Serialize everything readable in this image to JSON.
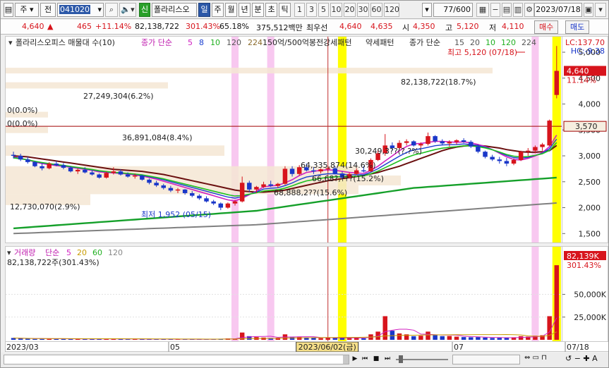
{
  "toolbar": {
    "market": "주",
    "type_label": "전",
    "code": "041020",
    "badge_new": "신",
    "stock_name": "폴라리스오",
    "periods": [
      "일",
      "주",
      "월",
      "년",
      "분",
      "초",
      "틱"
    ],
    "active_period": "일",
    "intervals": [
      "1",
      "3",
      "5",
      "10",
      "20",
      "30",
      "60",
      "120"
    ],
    "count": "77",
    "count_total": "/600",
    "date": "2023/07/18"
  },
  "quote": {
    "price": "4,640",
    "arrow": "▲",
    "change": "465",
    "change_pct": "+11.14%",
    "volume": "82,138,722",
    "volume_pct": "301.43%",
    "ratio": "65.18%",
    "amount": "375,512백만",
    "best_label": "최우선",
    "ask": "4,640",
    "bid": "4,635",
    "open_label": "시",
    "open": "4,350",
    "high_label": "고",
    "high": "5,120",
    "low_label": "저",
    "low": "4,110",
    "buy_label": "매수",
    "sell_label": "매도"
  },
  "price_legend": {
    "name": "폴라리스오피스 매물대 수(10)",
    "ma_label": "종가 단순",
    "ma_periods": [
      "5",
      "8",
      "10",
      "120",
      "224"
    ],
    "ma_colors": [
      "#d020c0",
      "#1a3fd0",
      "#20b020",
      "#555555",
      "#8a6a2a"
    ],
    "item3": "150억/500억봉전",
    "item4": "강세패턴",
    "item5": "약세패턴",
    "item6_label": "종가 단순",
    "item6_periods": [
      "15",
      "20",
      "10",
      "120",
      "224"
    ]
  },
  "price_notes": {
    "high_note": "최고 5,120 (07/18)",
    "low_note": "최저 1,952 (05/15)",
    "lc": "LC:137.70",
    "hc": "HC:-9.38",
    "cur_price": "4,640",
    "cur_pct": "11.14%",
    "ref_line": "3,570"
  },
  "price_axis": [
    "5,000",
    "4,500",
    "4,000",
    "3,500",
    "3,000",
    "2,500",
    "2,000",
    "1,500"
  ],
  "profile_labels": [
    {
      "text": "82,138,722(18.7%)"
    },
    {
      "text": "27,249,304(6.2%)"
    },
    {
      "text": "0(0.0%)"
    },
    {
      "text": "0(0.0%)"
    },
    {
      "text": "36,891,084(8.4%)"
    },
    {
      "text": "64,335,874(14.6%)"
    },
    {
      "text": "66,68?,???(15.2%)"
    },
    {
      "text": "68,888,2??(15.6%)"
    },
    {
      "text": "12,730,070(2.9%)"
    },
    {
      "text": "30,249,3??(?.?%)"
    }
  ],
  "volume_legend": {
    "name": "거래량",
    "ma_label": "단순",
    "periods": [
      "5",
      "20",
      "60",
      "120"
    ],
    "colors": [
      "#d020c0",
      "#c89b00",
      "#20b020",
      "#888888"
    ],
    "current": "82,138,722주(301.43%)",
    "axis_cur": "82,139K",
    "axis_pct": "301.43%"
  },
  "volume_axis": [
    "50,000K",
    "25,000K"
  ],
  "date_axis": {
    "labels": [
      "2023/03",
      "05",
      "07",
      "07/18"
    ],
    "cursor": "2023/06/02(금)"
  },
  "colors": {
    "up": "#d7141c",
    "down": "#1a37c9",
    "highlight_pink": "#f8c8f0",
    "highlight_yellow": "#ffff00",
    "profile": "#f4e6d4"
  },
  "chart_data": {
    "type": "candlestick",
    "y_range": [
      1300,
      5300
    ],
    "candles": [
      [
        3020,
        3080,
        2950,
        3000
      ],
      [
        3000,
        3040,
        2900,
        2930
      ],
      [
        2930,
        2980,
        2850,
        2880
      ],
      [
        2880,
        2900,
        2780,
        2800
      ],
      [
        2800,
        2850,
        2720,
        2760
      ],
      [
        2760,
        2880,
        2740,
        2850
      ],
      [
        2850,
        2900,
        2800,
        2820
      ],
      [
        2820,
        2860,
        2740,
        2770
      ],
      [
        2770,
        2800,
        2680,
        2700
      ],
      [
        2700,
        2760,
        2650,
        2730
      ],
      [
        2730,
        2780,
        2660,
        2680
      ],
      [
        2680,
        2720,
        2620,
        2640
      ],
      [
        2640,
        2660,
        2560,
        2580
      ],
      [
        2580,
        2700,
        2560,
        2670
      ],
      [
        2670,
        2780,
        2640,
        2700
      ],
      [
        2700,
        2740,
        2620,
        2640
      ],
      [
        2640,
        2680,
        2580,
        2600
      ],
      [
        2600,
        2660,
        2560,
        2620
      ],
      [
        2620,
        2640,
        2520,
        2540
      ],
      [
        2540,
        2560,
        2450,
        2480
      ],
      [
        2480,
        2520,
        2400,
        2430
      ],
      [
        2430,
        2460,
        2350,
        2380
      ],
      [
        2380,
        2420,
        2300,
        2330
      ],
      [
        2330,
        2380,
        2280,
        2350
      ],
      [
        2350,
        2360,
        2250,
        2280
      ],
      [
        2280,
        2320,
        2200,
        2230
      ],
      [
        2230,
        2260,
        2150,
        2180
      ],
      [
        2180,
        2220,
        2100,
        2120
      ],
      [
        2120,
        2150,
        2050,
        2080
      ],
      [
        2080,
        2100,
        1952,
        2000
      ],
      [
        2000,
        2100,
        1980,
        2080
      ],
      [
        2080,
        2150,
        2040,
        2120
      ],
      [
        2120,
        2600,
        2100,
        2480
      ],
      [
        2480,
        2520,
        2300,
        2350
      ],
      [
        2350,
        2420,
        2280,
        2400
      ],
      [
        2400,
        2500,
        2380,
        2450
      ],
      [
        2450,
        2520,
        2400,
        2420
      ],
      [
        2420,
        2480,
        2380,
        2460
      ],
      [
        2460,
        2800,
        2440,
        2750
      ],
      [
        2750,
        2800,
        2600,
        2650
      ],
      [
        2650,
        2820,
        2620,
        2780
      ],
      [
        2780,
        2850,
        2700,
        2720
      ],
      [
        2720,
        2780,
        2650,
        2700
      ],
      [
        2700,
        2760,
        2660,
        2740
      ],
      [
        2740,
        2800,
        2700,
        2760
      ],
      [
        2760,
        2800,
        2640,
        2660
      ],
      [
        2660,
        2700,
        2550,
        2580
      ],
      [
        2580,
        2680,
        2560,
        2650
      ],
      [
        2650,
        2760,
        2630,
        2720
      ],
      [
        2720,
        2800,
        2680,
        2700
      ],
      [
        2700,
        2950,
        2690,
        2920
      ],
      [
        2920,
        3100,
        2900,
        3050
      ],
      [
        3050,
        3420,
        3000,
        3200
      ],
      [
        3200,
        3260,
        3100,
        3150
      ],
      [
        3150,
        3300,
        3120,
        3250
      ],
      [
        3250,
        3320,
        3200,
        3280
      ],
      [
        3280,
        3300,
        3180,
        3200
      ],
      [
        3200,
        3260,
        3150,
        3230
      ],
      [
        3230,
        3450,
        3200,
        3380
      ],
      [
        3380,
        3400,
        3250,
        3280
      ],
      [
        3280,
        3320,
        3200,
        3240
      ],
      [
        3240,
        3300,
        3180,
        3270
      ],
      [
        3270,
        3320,
        3220,
        3300
      ],
      [
        3300,
        3340,
        3250,
        3270
      ],
      [
        3270,
        3300,
        3150,
        3180
      ],
      [
        3180,
        3220,
        3050,
        3080
      ],
      [
        3080,
        3100,
        2950,
        2980
      ],
      [
        2980,
        3020,
        2900,
        2930
      ],
      [
        2930,
        2980,
        2850,
        2900
      ],
      [
        2900,
        2960,
        2800,
        2850
      ],
      [
        2850,
        2950,
        2820,
        2920
      ],
      [
        2920,
        3100,
        2900,
        3080
      ],
      [
        3080,
        3150,
        3000,
        3100
      ],
      [
        3100,
        3200,
        3050,
        3170
      ],
      [
        3170,
        3250,
        3100,
        3220
      ],
      [
        3200,
        3700,
        3190,
        3680
      ],
      [
        4175,
        5120,
        4110,
        4640
      ]
    ],
    "volumes": [
      2,
      1.5,
      1.2,
      1,
      1.1,
      1.4,
      1,
      1.2,
      0.9,
      1,
      0.9,
      0.8,
      1,
      1.2,
      1.1,
      0.8,
      0.7,
      0.8,
      0.9,
      0.7,
      0.6,
      0.7,
      0.8,
      0.6,
      0.7,
      0.6,
      0.5,
      0.6,
      0.8,
      1.2,
      1.5,
      1.3,
      8,
      4,
      3,
      2.5,
      2,
      2.2,
      6,
      3,
      3.5,
      2.5,
      2,
      1.8,
      2.2,
      2.5,
      2,
      1.8,
      2,
      1.6,
      6,
      9,
      26,
      10,
      7,
      6,
      4,
      4.5,
      9,
      5,
      4,
      4.2,
      3.5,
      3,
      2.8,
      3,
      2.5,
      2,
      2.2,
      2,
      2.8,
      4,
      3.5,
      4.5,
      5,
      26,
      82.1
    ],
    "volume_range": [
      0,
      90
    ],
    "ma5": [
      2980,
      2950,
      2920,
      2880,
      2850,
      2830,
      2810,
      2800,
      2780,
      2760,
      2740,
      2720,
      2690,
      2680,
      2670,
      2660,
      2650,
      2630,
      2610,
      2580,
      2550,
      2510,
      2470,
      2430,
      2390,
      2350,
      2310,
      2270,
      2230,
      2190,
      2150,
      2130,
      2180,
      2250,
      2320,
      2400,
      2420,
      2430,
      2480,
      2540,
      2620,
      2680,
      2700,
      2720,
      2730,
      2720,
      2700,
      2680,
      2670,
      2660,
      2720,
      2800,
      2900,
      3000,
      3100,
      3180,
      3230,
      3240,
      3260,
      3280,
      3280,
      3270,
      3260,
      3270,
      3250,
      3220,
      3180,
      3120,
      3050,
      2980,
      2930,
      2920,
      2950,
      3000,
      3060,
      3180,
      3400
    ],
    "ma20": [
      3000,
      2990,
      2980,
      2960,
      2940,
      2920,
      2900,
      2880,
      2860,
      2840,
      2820,
      2800,
      2780,
      2760,
      2740,
      2730,
      2720,
      2710,
      2700,
      2680,
      2660,
      2640,
      2610,
      2580,
      2550,
      2520,
      2490,
      2460,
      2430,
      2400,
      2370,
      2340,
      2320,
      2310,
      2300,
      2300,
      2310,
      2320,
      2340,
      2370,
      2400,
      2430,
      2460,
      2490,
      2520,
      2540,
      2560,
      2580,
      2600,
      2620,
      2650,
      2680,
      2720,
      2760,
      2800,
      2850,
      2900,
      2950,
      3000,
      3050,
      3100,
      3140,
      3170,
      3190,
      3200,
      3200,
      3190,
      3170,
      3150,
      3120,
      3100,
      3080,
      3070,
      3070,
      3080,
      3100,
      3200
    ],
    "ma120": [
      1600,
      1610,
      1620,
      1630,
      1640,
      1650,
      1660,
      1670,
      1680,
      1690,
      1700,
      1710,
      1720,
      1730,
      1740,
      1750,
      1760,
      1770,
      1780,
      1790,
      1800,
      1810,
      1820,
      1830,
      1840,
      1850,
      1860,
      1870,
      1880,
      1890,
      1900,
      1910,
      1920,
      1930,
      1940,
      1960,
      1980,
      2000,
      2020,
      2040,
      2060,
      2080,
      2100,
      2120,
      2140,
      2160,
      2180,
      2200,
      2220,
      2240,
      2260,
      2280,
      2300,
      2320,
      2340,
      2360,
      2380,
      2390,
      2400,
      2410,
      2420,
      2430,
      2440,
      2450,
      2460,
      2470,
      2480,
      2490,
      2500,
      2510,
      2520,
      2530,
      2540,
      2550,
      2560,
      2570,
      2580
    ],
    "ma224": [
      1500,
      1505,
      1510,
      1515,
      1520,
      1525,
      1530,
      1535,
      1540,
      1545,
      1550,
      1555,
      1560,
      1565,
      1570,
      1575,
      1580,
      1585,
      1590,
      1595,
      1600,
      1605,
      1610,
      1615,
      1620,
      1625,
      1630,
      1635,
      1640,
      1645,
      1650,
      1655,
      1660,
      1665,
      1670,
      1680,
      1690,
      1700,
      1710,
      1720,
      1730,
      1740,
      1750,
      1760,
      1770,
      1780,
      1790,
      1800,
      1810,
      1820,
      1830,
      1840,
      1850,
      1860,
      1870,
      1880,
      1890,
      1900,
      1910,
      1920,
      1930,
      1940,
      1950,
      1960,
      1970,
      1980,
      1990,
      2000,
      2010,
      2020,
      2030,
      2040,
      2050,
      2060,
      2070,
      2080,
      2090
    ],
    "highlights_pink": [
      31,
      36,
      73
    ],
    "highlights_yellow": [
      46,
      76
    ],
    "cursor_index": 44
  }
}
